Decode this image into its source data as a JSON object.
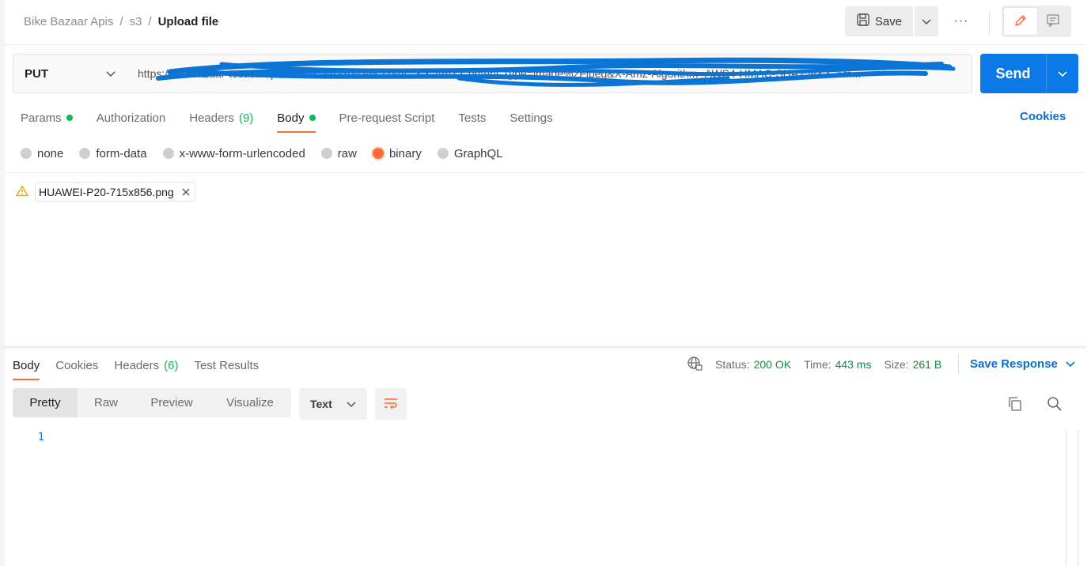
{
  "breadcrumb": {
    "items": [
      "Bike Bazaar Apis",
      "s3"
    ],
    "separator": "/",
    "current": "Upload file"
  },
  "toolbar": {
    "save_label": "Save",
    "more_label": "···"
  },
  "request": {
    "method": "PUT",
    "url": "https://bikebazaar-test.s3.ap-south-1.amazonaws.com/...&X-Amz-Content-Type=image%2Fjpeg&X-Amz-Algorithm=AWS4-HMAC-SHA256&X-Am...",
    "send_label": "Send"
  },
  "request_tabs": [
    {
      "label": "Params",
      "dot": true
    },
    {
      "label": "Authorization"
    },
    {
      "label": "Headers",
      "count": "(9)"
    },
    {
      "label": "Body",
      "dot": true,
      "active": true
    },
    {
      "label": "Pre-request Script"
    },
    {
      "label": "Tests"
    },
    {
      "label": "Settings"
    }
  ],
  "cookies_label": "Cookies",
  "body_types": [
    {
      "label": "none"
    },
    {
      "label": "form-data"
    },
    {
      "label": "x-www-form-urlencoded"
    },
    {
      "label": "raw"
    },
    {
      "label": "binary",
      "selected": true
    },
    {
      "label": "GraphQL"
    }
  ],
  "file": {
    "name": "HUAWEI-P20-715x856.png"
  },
  "response_tabs": [
    {
      "label": "Body",
      "active": true
    },
    {
      "label": "Cookies"
    },
    {
      "label": "Headers",
      "count": "(6)"
    },
    {
      "label": "Test Results"
    }
  ],
  "response_status": {
    "status_label": "Status:",
    "status_value": "200 OK",
    "time_label": "Time:",
    "time_value": "443 ms",
    "size_label": "Size:",
    "size_value": "261 B"
  },
  "save_response_label": "Save Response",
  "view_modes": [
    "Pretty",
    "Raw",
    "Preview",
    "Visualize"
  ],
  "format_label": "Text",
  "editor": {
    "line_number": "1"
  },
  "colors": {
    "accent": "#ff6c37",
    "send": "#0b79e6",
    "link": "#0b6fd1",
    "success": "#0cbb52"
  }
}
